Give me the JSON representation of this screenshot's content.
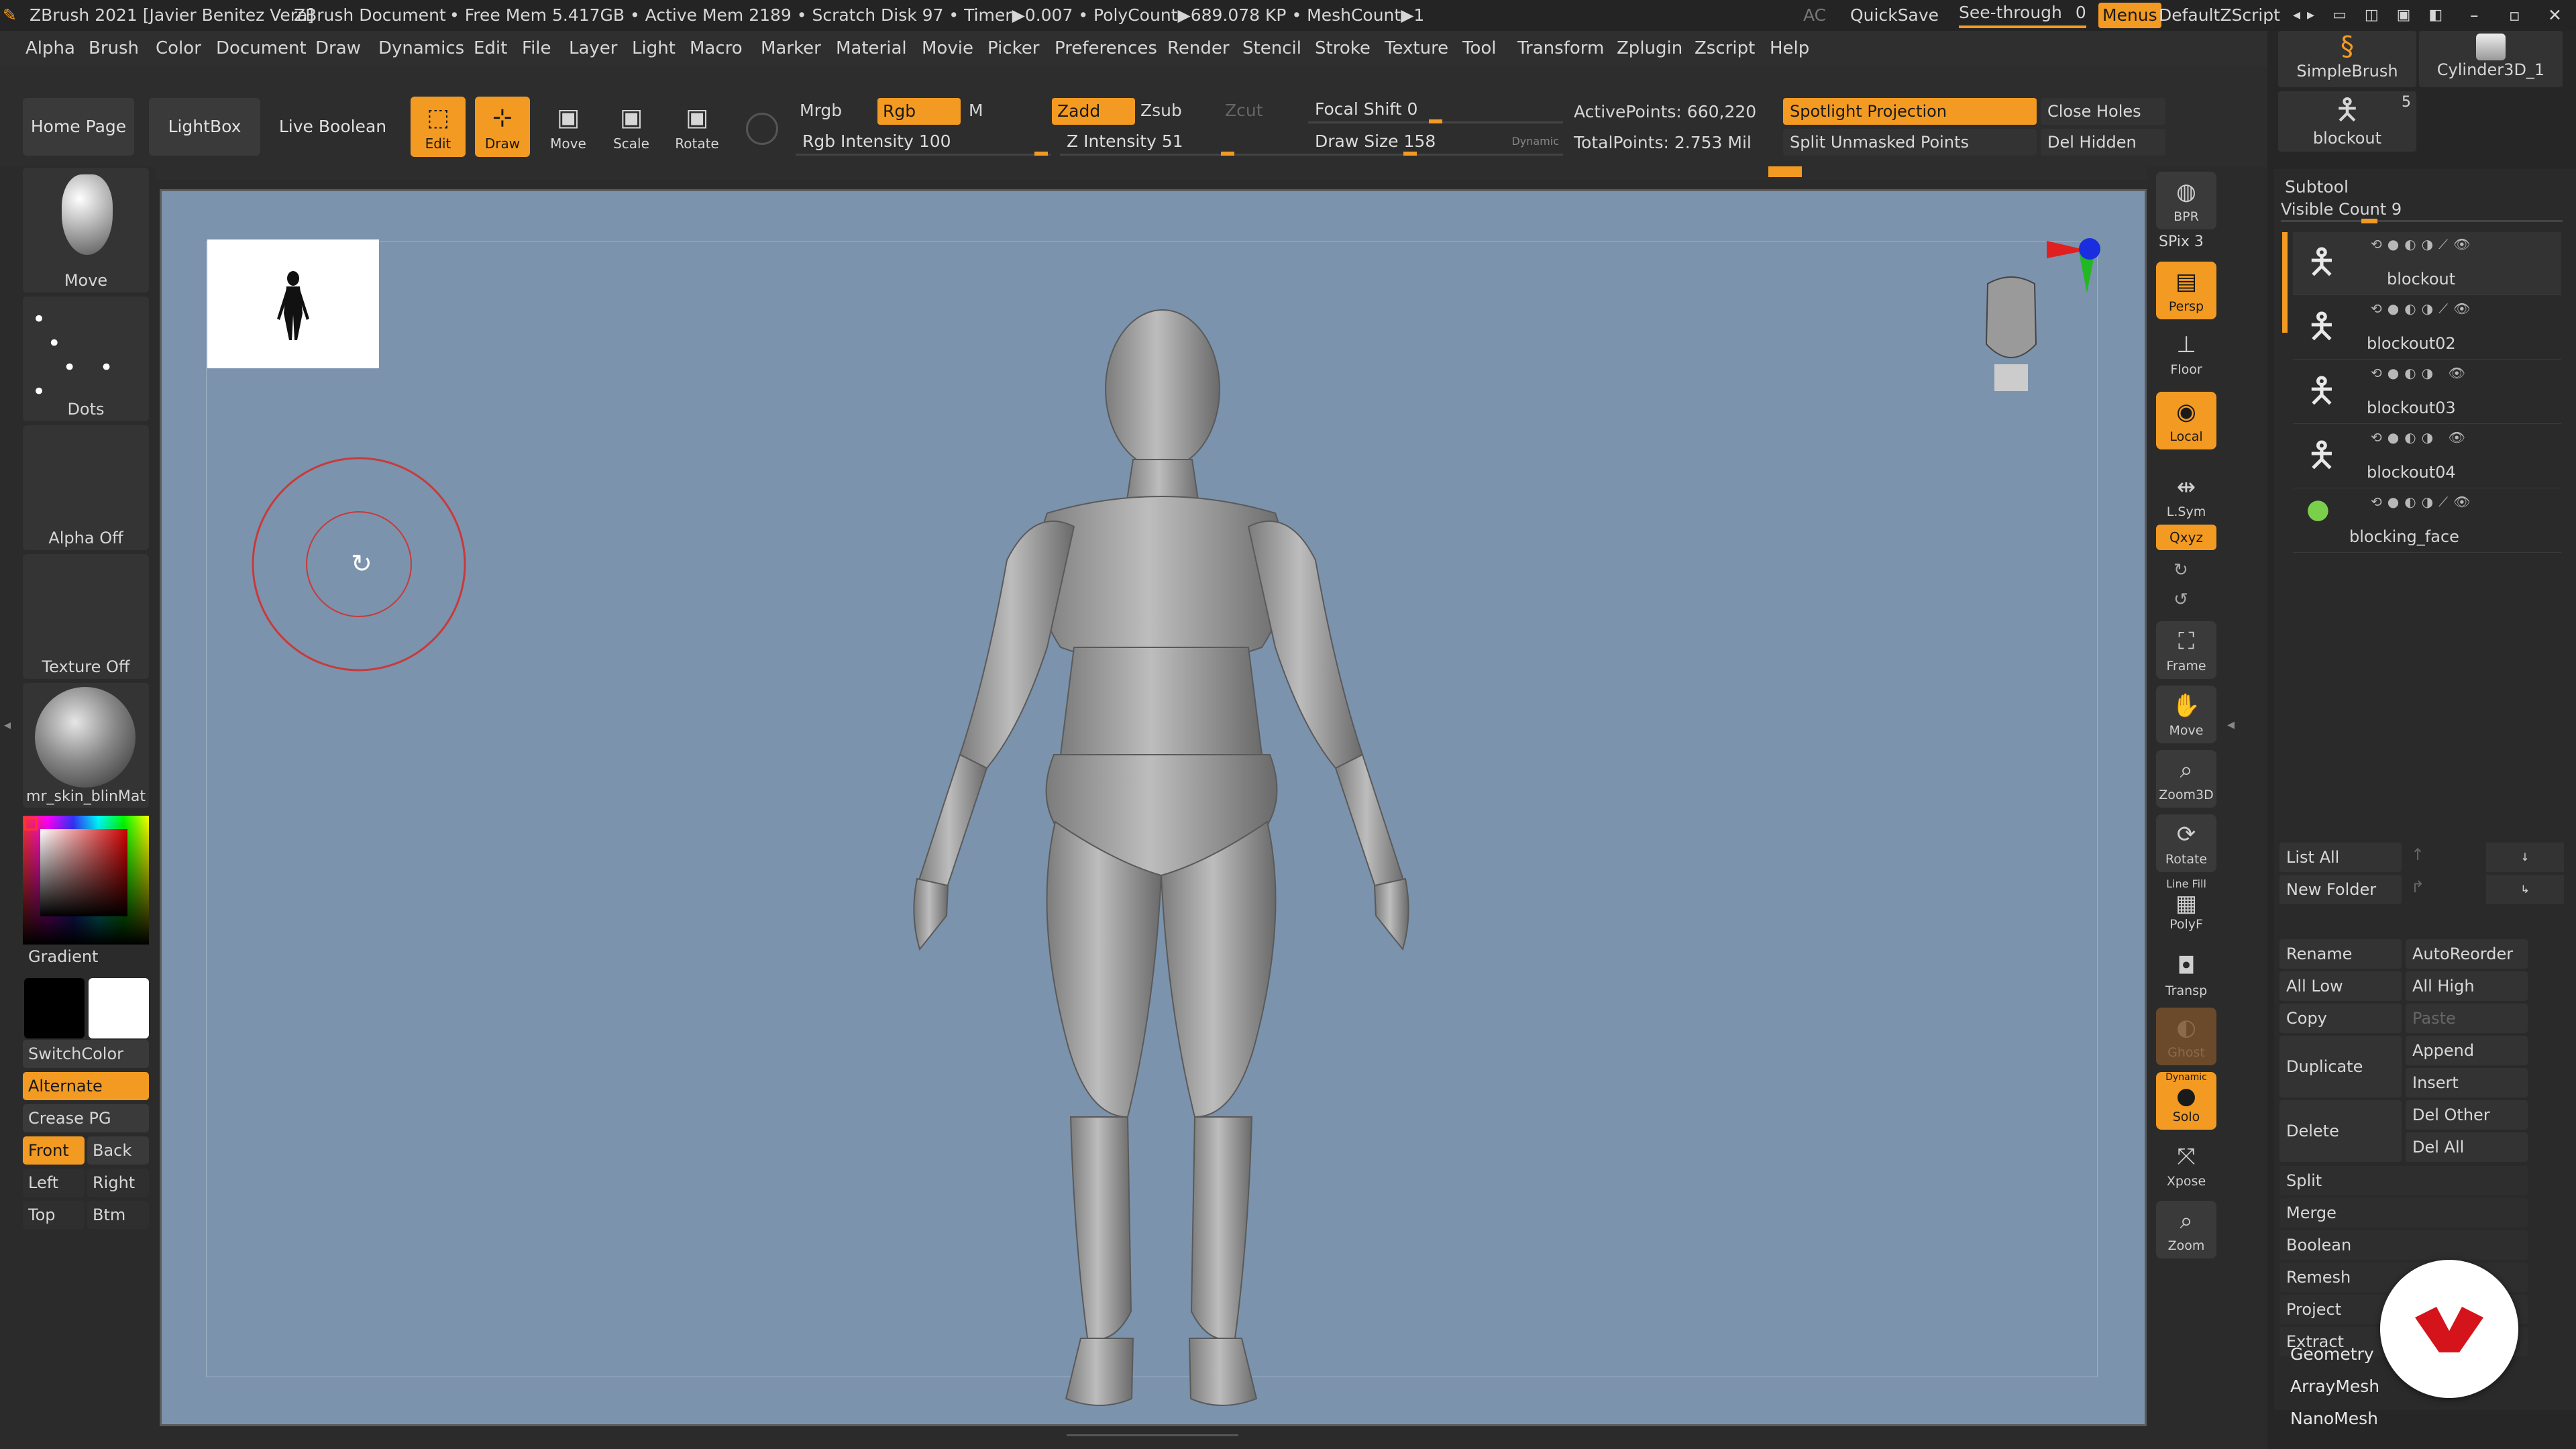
{
  "app": {
    "title": "ZBrush 2021 [Javier Benitez Vera]",
    "document": "ZBrush Document",
    "stats": "• Free Mem 5.417GB • Active Mem 2189 • Scratch Disk 97 • Timer▶0.007 • PolyCount▶689.078 KP • MeshCount▶1",
    "ac": "AC",
    "quicksave": "QuickSave",
    "see_through": "See-through",
    "see_through_value": "0",
    "menus": "Menus",
    "script": "DefaultZScript"
  },
  "menu": [
    "Alpha",
    "Brush",
    "Color",
    "Document",
    "Draw",
    "Dynamics",
    "Edit",
    "File",
    "Layer",
    "Light",
    "Macro",
    "Marker",
    "Material",
    "Movie",
    "Picker",
    "Preferences",
    "Render",
    "Stencil",
    "Stroke",
    "Texture",
    "Tool",
    "Transform",
    "Zplugin",
    "Zscript",
    "Help"
  ],
  "toolbar": {
    "home_page": "Home Page",
    "lightbox": "LightBox",
    "live_boolean": "Live Boolean",
    "edit": "Edit",
    "draw": "Draw",
    "move": "Move",
    "scale": "Scale",
    "rotate": "Rotate",
    "mrgb": "Mrgb",
    "rgb": "Rgb",
    "m": "M",
    "rgb_intensity": "Rgb Intensity 100",
    "zadd": "Zadd",
    "zsub": "Zsub",
    "zcut": "Zcut",
    "z_intensity": "Z Intensity 51",
    "focal_shift": "Focal Shift 0",
    "draw_size": "Draw Size 158",
    "dynamic": "Dynamic",
    "active_points": "ActivePoints: 660,220",
    "total_points": "TotalPoints: 2.753 Mil",
    "spotlight_projection": "Spotlight Projection",
    "split_unmasked": "Split Unmasked Points",
    "close_holes": "Close Holes",
    "del_hidden": "Del Hidden"
  },
  "left_shelf": {
    "brush": "Move",
    "stroke": "Dots",
    "alpha": "Alpha Off",
    "texture": "Texture Off",
    "material": "mr_skin_blinMat",
    "gradient": "Gradient",
    "switch_color": "SwitchColor",
    "alternate": "Alternate",
    "crease_pg": "Crease PG",
    "front": "Front",
    "back": "Back",
    "left": "Left",
    "right": "Right",
    "top": "Top",
    "btm": "Btm"
  },
  "right_shelf": {
    "bpr": "BPR",
    "spix": "SPix 3",
    "dynamic": "Dynamic",
    "persp": "Persp",
    "floor": "Floor",
    "local": "Local",
    "lsym": "L.Sym",
    "xyz": "Qxyz",
    "frame": "Frame",
    "move": "Move",
    "zoom3d": "Zoom3D",
    "rotate": "Rotate",
    "line_fill": "Line Fill",
    "polyf": "PolyF",
    "transp": "Transp",
    "ghost": "Ghost",
    "solo": "Solo",
    "xpose": "Xpose",
    "zoom": "Zoom"
  },
  "tool_panel": {
    "simple_brush": "SimpleBrush",
    "cylinder": "Cylinder3D_1",
    "blockout": "blockout",
    "blockout_count": "5",
    "subtool": "Subtool",
    "visible_count": "Visible Count 9",
    "subtools": [
      "blockout",
      "blockout02",
      "blockout03",
      "blockout04",
      "blocking_face"
    ],
    "list_all": "List All",
    "new_folder": "New Folder",
    "rename": "Rename",
    "autoreorder": "AutoReorder",
    "all_low": "All Low",
    "all_high": "All High",
    "copy": "Copy",
    "paste": "Paste",
    "duplicate": "Duplicate",
    "append": "Append",
    "insert": "Insert",
    "delete": "Delete",
    "del_other": "Del Other",
    "del_all": "Del All",
    "split": "Split",
    "merge": "Merge",
    "boolean": "Boolean",
    "remesh": "Remesh",
    "project": "Project",
    "extract": "Extract",
    "geometry": "Geometry",
    "arraymesh": "ArrayMesh",
    "nanomesh": "NanoMesh"
  },
  "colors": {
    "accent": "#f39a22",
    "canvas": "#7b93ad",
    "brush_ring": "#c83a3a"
  }
}
